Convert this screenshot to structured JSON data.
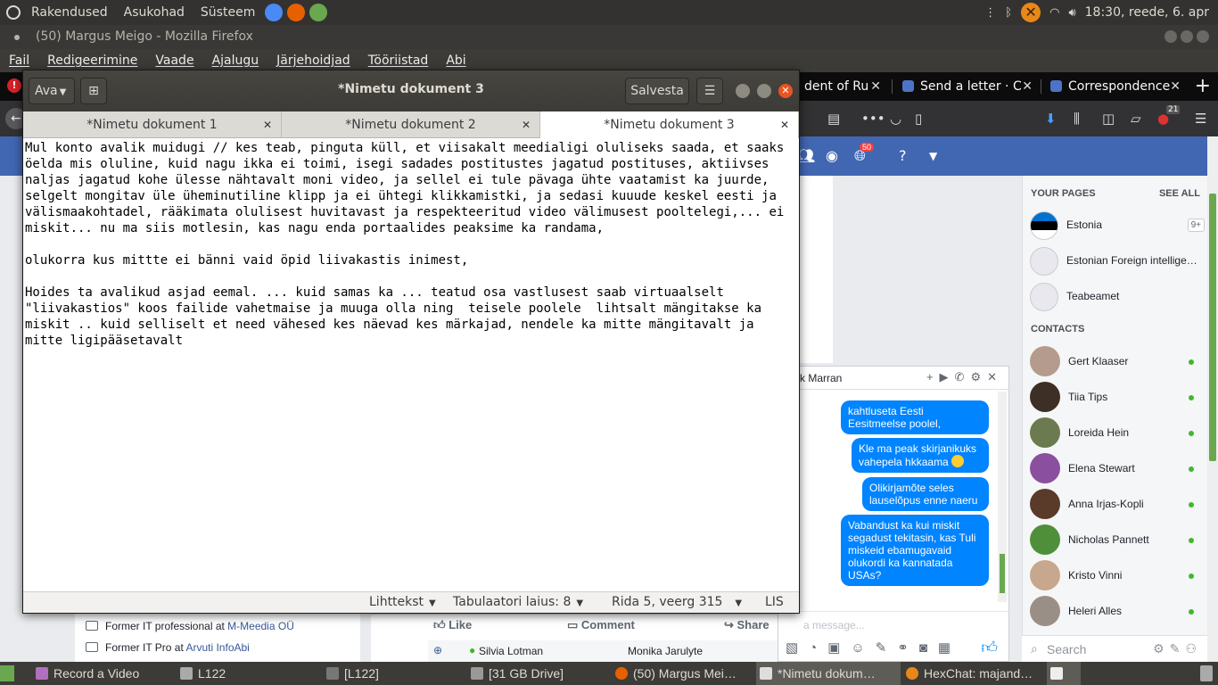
{
  "top_panel": {
    "menus": [
      "Rakendused",
      "Asukohad",
      "Süsteem"
    ],
    "clock": "18:30, reede,  6. apr"
  },
  "firefox": {
    "title": "(50) Margus Meigo - Mozilla Firefox",
    "menubar": [
      "Fail",
      "Redigeerimine",
      "Vaade",
      "Ajalugu",
      "Järjehoidjad",
      "Tööriistad",
      "Abi"
    ],
    "tabs": [
      {
        "label": "dent of Ru"
      },
      {
        "label": "Send a letter · C"
      },
      {
        "label": "Correspondence"
      }
    ],
    "toolbar_badge": "21",
    "fb_notif_count": "50"
  },
  "gedit": {
    "title": "*Nimetu dokument 3",
    "open_label": "Ava",
    "save_label": "Salvesta",
    "tabs": [
      {
        "label": "*Nimetu dokument 1"
      },
      {
        "label": "*Nimetu dokument 2"
      },
      {
        "label": "*Nimetu dokument 3"
      }
    ],
    "text": "Mul konto avalik muidugi // kes teab, pinguta küll, et viisakalt meedialigi oluliseks saada, et saaks öelda mis oluline, kuid nagu ikka ei toimi, isegi sadades postitustes jagatud postituses, aktiivses naljas jagatud kohe ülesse nähtavalt moni video, ja sellel ei tule pävaga ühte vaatamist ka juurde, selgelt mongitav üle üheminutiline klipp ja ei ühtegi klikkamistki, ja sedasi kuuude keskel eesti ja välismaakohtadel, rääkimata olulisest huvitavast ja respekteeritud video välimusest pooltelegi,... ei miskit... nu ma siis motlesin, kas nagu enda portaalides peaksime ka randama,\n\nolukorra kus mittte ei bänni vaid öpid liivakastis inimest,\n\nHoides ta avalikud asjad eemal. ... kuid samas ka ... teatud osa vastlusest saab virtuaalselt \"liivakastios\" koos failide vahetmaise ja muuga olla ning  teisele poolele  lihtsalt mängitakse ka miskit .. kuid selliselt et need vähesed kes näevad kes märkajad, nendele ka mitte mängitavalt ja mitte ligipääsetavalt",
    "status": {
      "syntax": "Lihttekst",
      "tab_width": "Tabulaatori laius: 8",
      "position": "Rida 5, veerg 315",
      "mode": "LIS"
    }
  },
  "facebook": {
    "work": [
      {
        "prefix": "Former IT professional at ",
        "link": "M-Meedia OÜ"
      },
      {
        "prefix": "Former IT Pro at ",
        "link": "Arvuti InfoAbi"
      }
    ],
    "actions": {
      "like": "Like",
      "comment": "Comment",
      "share": "Share"
    },
    "commenters": [
      "Silvia Lotman",
      "Monika Jarulyte"
    ],
    "sidebar": {
      "your_pages": "YOUR PAGES",
      "see_all": "SEE ALL",
      "pages": [
        {
          "name": "Estonia",
          "count": "9+"
        },
        {
          "name": "Estonian Foreign intellige…",
          "count": ""
        },
        {
          "name": "Teabeamet",
          "count": ""
        }
      ],
      "contacts_label": "CONTACTS",
      "contacts": [
        "Gert Klaaser",
        "Tiia Tips",
        "Loreida Hein",
        "Elena Stewart",
        "Anna Irjas-Kopli",
        "Nicholas Pannett",
        "Kristo Vinni",
        "Heleri Alles"
      ],
      "search_placeholder": "Search"
    },
    "chat": {
      "name": "k Marran",
      "messages": [
        "kahtluseta Eesti Eesitmeelse poolel,",
        "Kle ma peak skirjanikuks vahepela hkkaama",
        "Olikirjamõte seles lauselõpus enne naeru",
        "Vabandust ka kui miskit segadust tekitasin, kas Tuli miskeid  ebamugavaid olukordi ka kannatada USAs?"
      ],
      "placeholder": "a message..."
    }
  },
  "taskbar": {
    "items": [
      "Record a Video",
      "L122",
      "[L122]",
      "[31 GB Drive]",
      "(50) Margus Mei…",
      "*Nimetu dokum…",
      "HexChat: majand…"
    ]
  }
}
